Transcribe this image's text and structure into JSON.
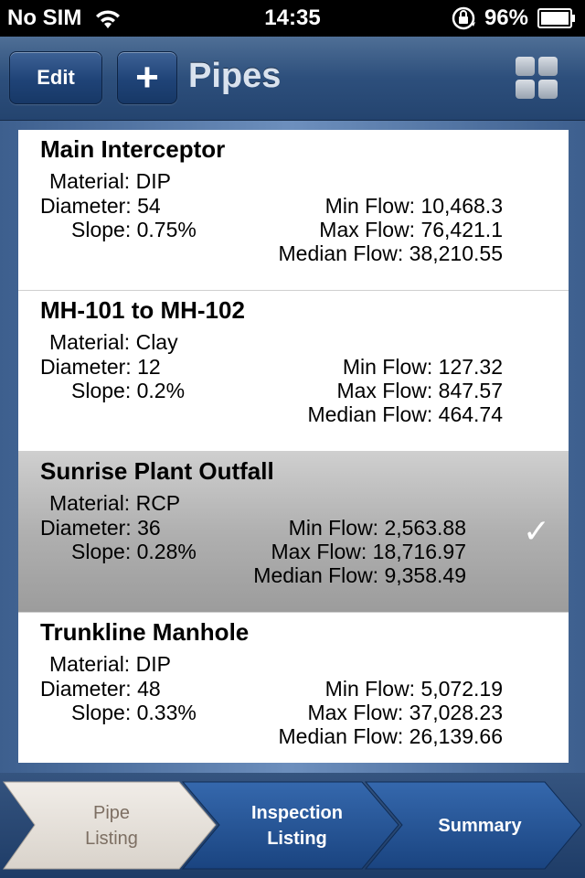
{
  "status_bar": {
    "carrier": "No SIM",
    "time": "14:35",
    "battery": "96%",
    "icons": [
      "wifi-icon",
      "orientation-lock-icon",
      "battery-icon"
    ]
  },
  "nav": {
    "edit_label": "Edit",
    "add_label": "+",
    "title": "Pipes",
    "grid_icon": "grid-view-icon"
  },
  "pipes": [
    {
      "name": "Main Interceptor",
      "material": "Material: DIP",
      "diameter": "Diameter: 54",
      "slope": "Slope: 0.75%",
      "min_flow": "Min Flow: 10,468.3",
      "max_flow": "Max Flow: 76,421.1",
      "median_flow": "Median Flow: 38,210.55",
      "selected": false
    },
    {
      "name": "MH-101 to MH-102",
      "material": "Material: Clay",
      "diameter": "Diameter: 12",
      "slope": "Slope: 0.2%",
      "min_flow": "Min Flow: 127.32",
      "max_flow": "Max Flow: 847.57",
      "median_flow": "Median Flow: 464.74",
      "selected": false
    },
    {
      "name": "Sunrise Plant Outfall",
      "material": "Material: RCP",
      "diameter": "Diameter: 36",
      "slope": "Slope: 0.28%",
      "min_flow": "Min Flow: 2,563.88",
      "max_flow": "Max Flow: 18,716.97",
      "median_flow": "Median Flow: 9,358.49",
      "selected": true,
      "check": "✓"
    },
    {
      "name": "Trunkline Manhole",
      "material": "Material: DIP",
      "diameter": "Diameter: 48",
      "slope": "Slope: 0.33%",
      "min_flow": "Min Flow: 5,072.19",
      "max_flow": "Max Flow: 37,028.23",
      "median_flow": "Median Flow: 26,139.66",
      "selected": false
    }
  ],
  "tabs": [
    {
      "line1": "Pipe",
      "line2": "Listing",
      "active": true
    },
    {
      "line1": "Inspection",
      "line2": "Listing",
      "active": false
    },
    {
      "line1": "Summary",
      "active": false
    }
  ],
  "colors": {
    "nav_blue": "#2d4f7c",
    "active_tab": "#e6e1da",
    "inactive_tab": "#1f4a86",
    "selected_row": "#b0b0b0"
  }
}
